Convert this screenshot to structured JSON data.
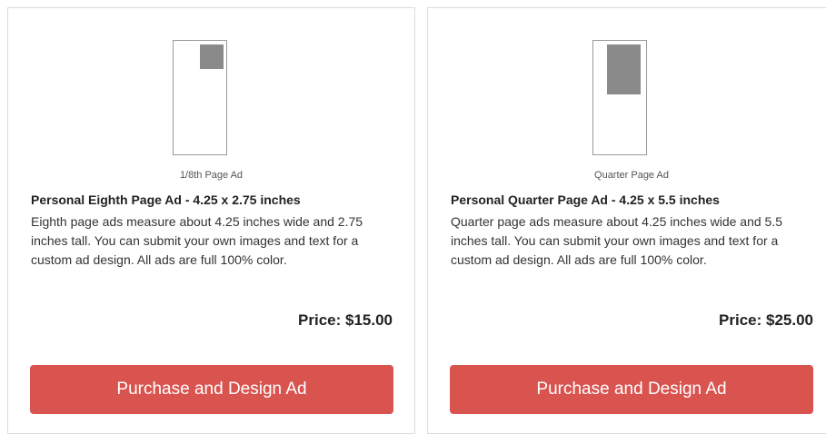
{
  "products": [
    {
      "thumb_caption": "1/8th Page Ad",
      "title": "Personal Eighth Page Ad - 4.25 x 2.75 inches",
      "description": "Eighth page ads measure about 4.25 inches wide and 2.75 inches tall. You can submit your own images and text for a custom ad design. All ads are full 100% color.",
      "price": "Price: $15.00",
      "button_label": "Purchase and Design Ad"
    },
    {
      "thumb_caption": "Quarter Page Ad",
      "title": "Personal Quarter Page Ad - 4.25 x 5.5 inches",
      "description": "Quarter page ads measure about 4.25 inches wide and 5.5 inches tall. You can submit your own images and text for a custom ad design. All ads are full 100% color.",
      "price": "Price: $25.00",
      "button_label": "Purchase and Design Ad"
    }
  ],
  "colors": {
    "button_bg": "#d9534f",
    "button_text": "#ffffff",
    "card_border": "#dcdcdc",
    "thumb_fill": "#8a8a8a"
  }
}
